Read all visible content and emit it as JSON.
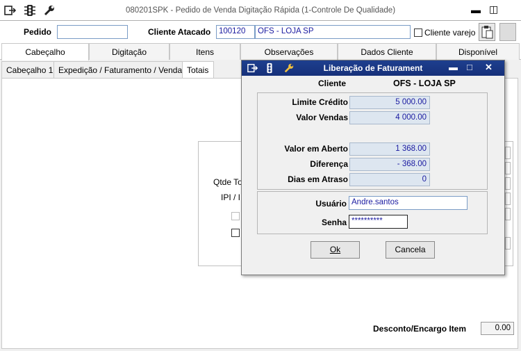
{
  "window": {
    "title": "080201SPK - Pedido de Venda Digitação Rápida (1-Controle De Qualidade)"
  },
  "header": {
    "pedido_label": "Pedido",
    "pedido_value": "",
    "cliente_label": "Cliente Atacado",
    "cliente_code": "100120",
    "cliente_name": "OFS - LOJA SP",
    "cliente_varejo_label": "Cliente varejo"
  },
  "tabs": [
    "Cabeçalho",
    "Digitação",
    "Itens",
    "Observações",
    "Dados Cliente",
    "Disponível"
  ],
  "subtabs": [
    "Cabeçalho 1",
    "Expedição / Faturamento / Vendas",
    "Totais"
  ],
  "background": {
    "qtde_label": "Qtde To",
    "ipi_label": "IPI / I",
    "desconto_label": "Desconto/Encargo Item",
    "desconto_value": "0.00"
  },
  "dialog": {
    "title": "Liberação de Faturament",
    "cliente_label": "Cliente",
    "cliente_value": "OFS - LOJA SP",
    "limite_label": "Limite Crédito",
    "limite_value": "5 000.00",
    "vendas_label": "Valor Vendas",
    "vendas_value": "4 000.00",
    "aberto_label": "Valor em Aberto",
    "aberto_value": "1 368.00",
    "diferenca_label": "Diferença",
    "diferenca_value": "- 368.00",
    "atraso_label": "Dias em Atraso",
    "atraso_value": "0",
    "usuario_label": "Usuário",
    "usuario_value": "Andre.santos",
    "senha_label": "Senha",
    "senha_value": "**********",
    "ok_label": "Ok",
    "cancela_label": "Cancela"
  },
  "colors": {
    "accent": "#1e3f8e",
    "value_text": "#1a1aa0"
  }
}
